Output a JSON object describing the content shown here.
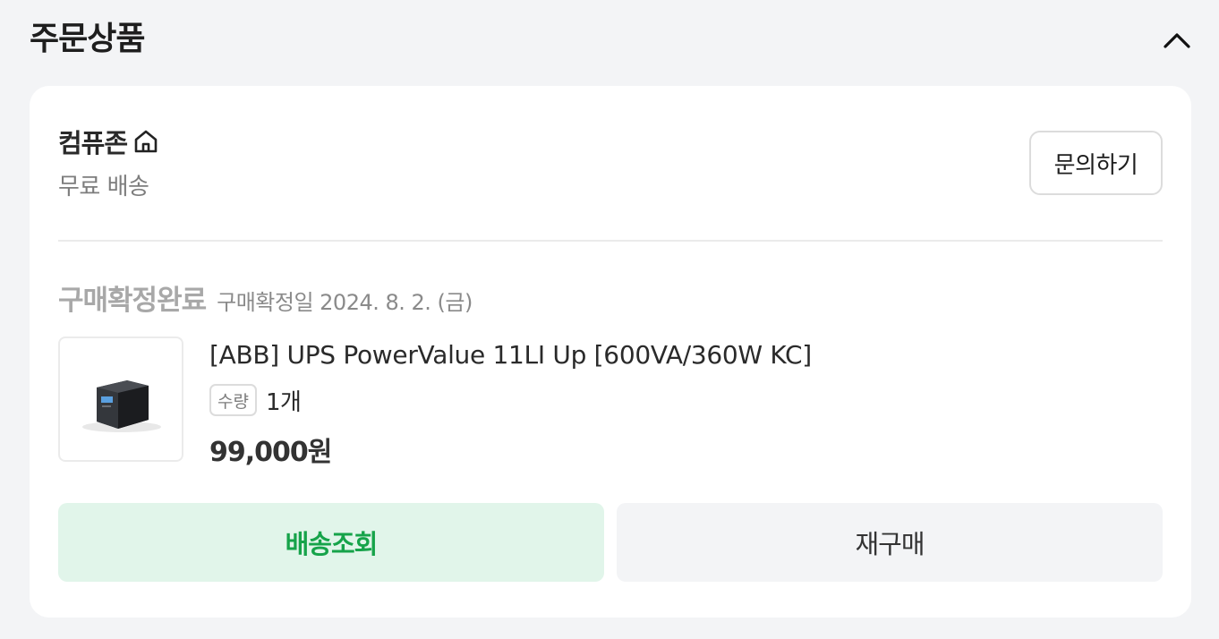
{
  "section": {
    "title": "주문상품"
  },
  "seller": {
    "name": "컴퓨존",
    "shipping": "무료 배송",
    "inquiry_label": "문의하기"
  },
  "order": {
    "status": "구매확정완료",
    "status_date": "구매확정일 2024. 8. 2. (금)"
  },
  "product": {
    "name": "[ABB] UPS PowerValue 11LI Up [600VA/360W KC]",
    "qty_label": "수량",
    "qty_value": "1개",
    "price": "99,000원"
  },
  "actions": {
    "track_label": "배송조회",
    "rebuy_label": "재구매"
  },
  "icons": {
    "collapse": "chevron-up-icon",
    "store": "home-icon"
  },
  "colors": {
    "accent_green": "#16a34a",
    "track_bg": "#e1f5ea",
    "page_bg": "#f3f4f6"
  }
}
